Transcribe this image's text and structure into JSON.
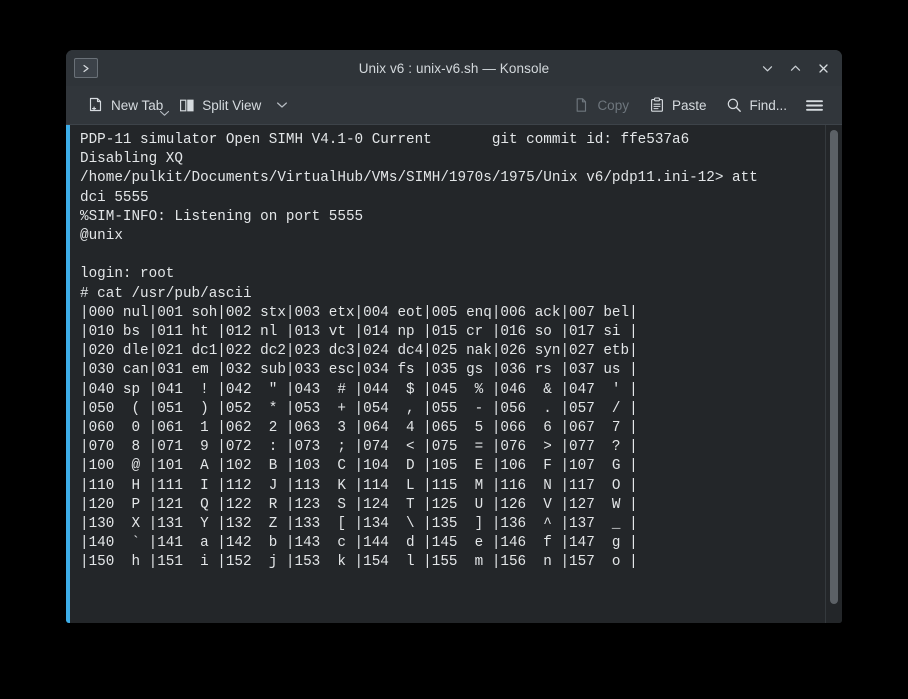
{
  "window": {
    "title": "Unix v6 : unix-v6.sh — Konsole",
    "app_icon": "terminal-prompt-icon",
    "controls": {
      "minimize_label": "Minimize",
      "maximize_label": "Maximize",
      "close_label": "Close"
    },
    "accent_color": "#3daee9",
    "titlebar_color": "#2f3439",
    "toolbar_color": "#31363b",
    "terminal_bg_color": "#232629",
    "terminal_fg_color": "#e3e6e8"
  },
  "toolbar": {
    "left": [
      {
        "id": "new-tab",
        "label": "New Tab",
        "icon": "new-tab-icon",
        "has_menu": true,
        "enabled": true
      },
      {
        "id": "split-view",
        "label": "Split View",
        "icon": "split-view-icon",
        "has_menu": true,
        "enabled": true
      }
    ],
    "right": [
      {
        "id": "copy",
        "label": "Copy",
        "icon": "copy-icon",
        "enabled": false
      },
      {
        "id": "paste",
        "label": "Paste",
        "icon": "paste-icon",
        "enabled": true
      },
      {
        "id": "find",
        "label": "Find...",
        "icon": "search-icon",
        "enabled": true
      },
      {
        "id": "menu",
        "label": "",
        "icon": "hamburger-menu-icon",
        "enabled": true
      }
    ]
  },
  "terminal": {
    "lines": [
      "PDP-11 simulator Open SIMH V4.1-0 Current       git commit id: ffe537a6",
      "Disabling XQ",
      "/home/pulkit/Documents/VirtualHub/VMs/SIMH/1970s/1975/Unix v6/pdp11.ini-12> att",
      "dci 5555",
      "%SIM-INFO: Listening on port 5555",
      "@unix",
      "",
      "login: root",
      "# cat /usr/pub/ascii",
      "|000 nul|001 soh|002 stx|003 etx|004 eot|005 enq|006 ack|007 bel|",
      "|010 bs |011 ht |012 nl |013 vt |014 np |015 cr |016 so |017 si |",
      "|020 dle|021 dc1|022 dc2|023 dc3|024 dc4|025 nak|026 syn|027 etb|",
      "|030 can|031 em |032 sub|033 esc|034 fs |035 gs |036 rs |037 us |",
      "|040 sp |041  ! |042  \" |043  # |044  $ |045  % |046  & |047  ' |",
      "|050  ( |051  ) |052  * |053  + |054  , |055  - |056  . |057  / |",
      "|060  0 |061  1 |062  2 |063  3 |064  4 |065  5 |066  6 |067  7 |",
      "|070  8 |071  9 |072  : |073  ; |074  < |075  = |076  > |077  ? |",
      "|100  @ |101  A |102  B |103  C |104  D |105  E |106  F |107  G |",
      "|110  H |111  I |112  J |113  K |114  L |115  M |116  N |117  O |",
      "|120  P |121  Q |122  R |123  S |124  T |125  U |126  V |127  W |",
      "|130  X |131  Y |132  Z |133  [ |134  \\ |135  ] |136  ^ |137  _ |",
      "|140  ` |141  a |142  b |143  c |144  d |145  e |146  f |147  g |",
      "|150  h |151  i |152  j |153  k |154  l |155  m |156  n |157  o |"
    ],
    "scrollbar": {
      "name": "vertical-scrollbar",
      "thumb_color": "#5c6166"
    }
  }
}
